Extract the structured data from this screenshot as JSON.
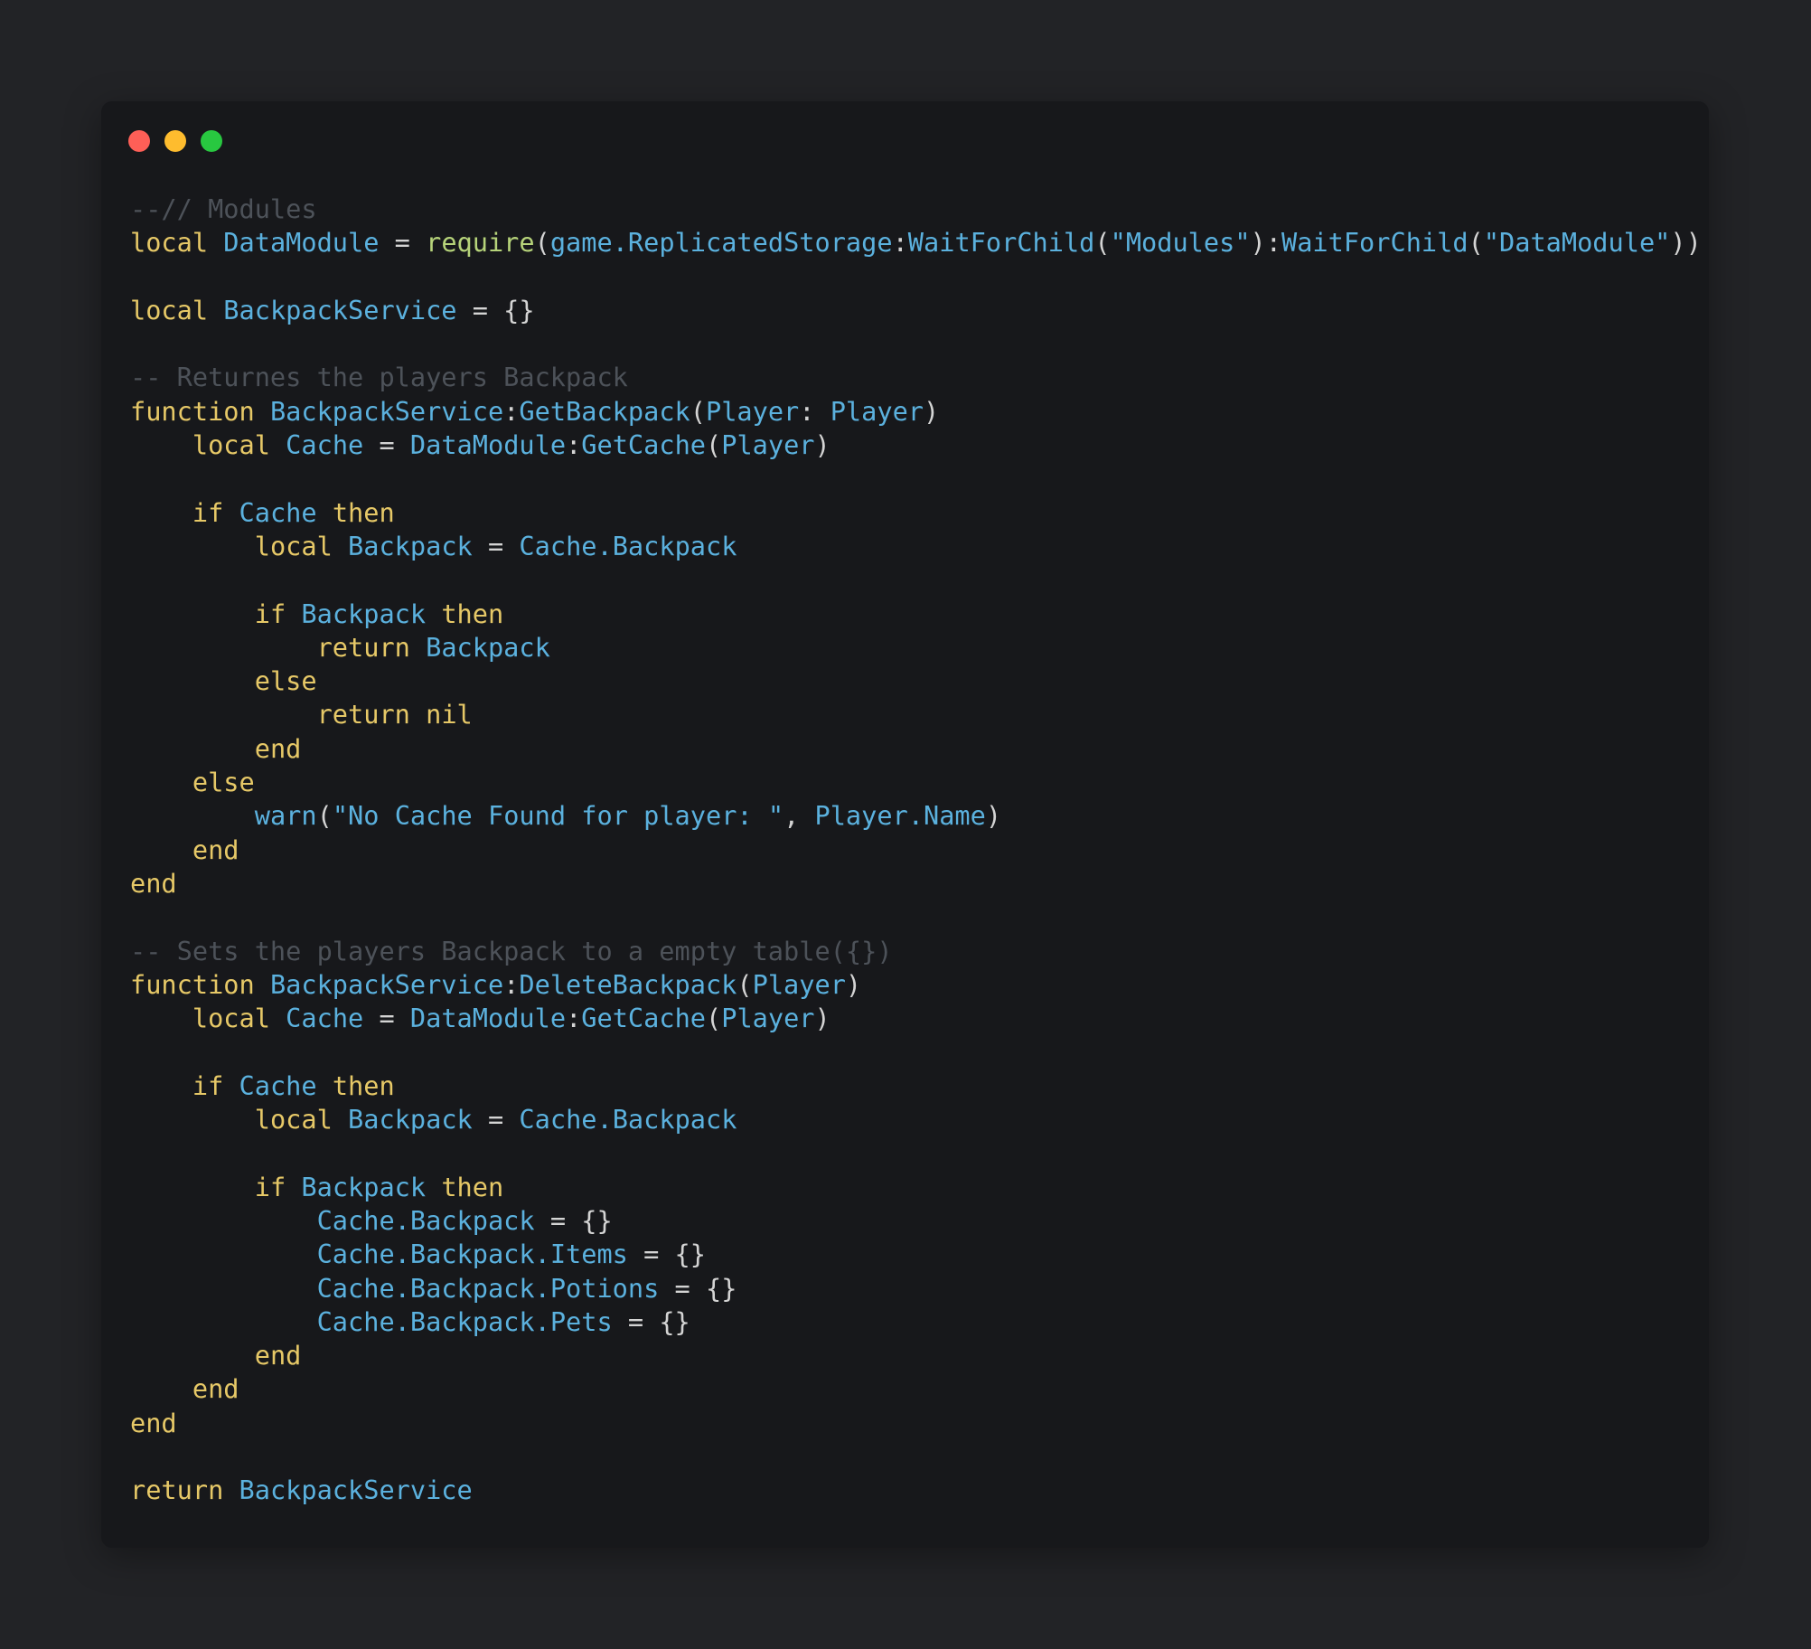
{
  "colors": {
    "background": "#222326",
    "window": "#17181b",
    "close_dot": "#fe5f57",
    "minimize_dot": "#febc2e",
    "maximize_dot": "#28c840",
    "keyword": "#e6c867",
    "identifier": "#5bb1de",
    "builtin": "#b6d37a",
    "comment": "#4d5259",
    "operator": "#d4d4d4"
  },
  "window_controls": [
    "close-dot",
    "minimize-dot",
    "maximize-dot"
  ],
  "code_lines": [
    [
      [
        "comment",
        "--// Modules"
      ]
    ],
    [
      [
        "keyword",
        "local "
      ],
      [
        "ident",
        "DataModule"
      ],
      [
        "op",
        " = "
      ],
      [
        "builtin",
        "require"
      ],
      [
        "op",
        "("
      ],
      [
        "ident",
        "game.ReplicatedStorage"
      ],
      [
        "op",
        ":"
      ],
      [
        "ident",
        "WaitForChild"
      ],
      [
        "op",
        "("
      ],
      [
        "string",
        "\"Modules\""
      ],
      [
        "op",
        "):"
      ],
      [
        "ident",
        "WaitForChild"
      ],
      [
        "op",
        "("
      ],
      [
        "string",
        "\"DataModule\""
      ],
      [
        "op",
        "))"
      ]
    ],
    [],
    [
      [
        "keyword",
        "local "
      ],
      [
        "ident",
        "BackpackService"
      ],
      [
        "op",
        " = {}"
      ]
    ],
    [],
    [
      [
        "comment",
        "-- Returnes the players Backpack"
      ]
    ],
    [
      [
        "keyword",
        "function "
      ],
      [
        "ident",
        "BackpackService"
      ],
      [
        "op",
        ":"
      ],
      [
        "ident",
        "GetBackpack"
      ],
      [
        "op",
        "("
      ],
      [
        "ident",
        "Player"
      ],
      [
        "op",
        ": "
      ],
      [
        "ident",
        "Player"
      ],
      [
        "op",
        ")"
      ]
    ],
    [
      [
        "plain",
        "    "
      ],
      [
        "keyword",
        "local "
      ],
      [
        "ident",
        "Cache"
      ],
      [
        "op",
        " = "
      ],
      [
        "ident",
        "DataModule"
      ],
      [
        "op",
        ":"
      ],
      [
        "ident",
        "GetCache"
      ],
      [
        "op",
        "("
      ],
      [
        "ident",
        "Player"
      ],
      [
        "op",
        ")"
      ]
    ],
    [],
    [
      [
        "plain",
        "    "
      ],
      [
        "keyword",
        "if "
      ],
      [
        "ident",
        "Cache"
      ],
      [
        "keyword",
        " then"
      ]
    ],
    [
      [
        "plain",
        "        "
      ],
      [
        "keyword",
        "local "
      ],
      [
        "ident",
        "Backpack"
      ],
      [
        "op",
        " = "
      ],
      [
        "ident",
        "Cache.Backpack"
      ]
    ],
    [],
    [
      [
        "plain",
        "        "
      ],
      [
        "keyword",
        "if "
      ],
      [
        "ident",
        "Backpack"
      ],
      [
        "keyword",
        " then"
      ]
    ],
    [
      [
        "plain",
        "            "
      ],
      [
        "keyword",
        "return "
      ],
      [
        "ident",
        "Backpack"
      ]
    ],
    [
      [
        "plain",
        "        "
      ],
      [
        "keyword",
        "else"
      ]
    ],
    [
      [
        "plain",
        "            "
      ],
      [
        "keyword",
        "return nil"
      ]
    ],
    [
      [
        "plain",
        "        "
      ],
      [
        "keyword",
        "end"
      ]
    ],
    [
      [
        "plain",
        "    "
      ],
      [
        "keyword",
        "else"
      ]
    ],
    [
      [
        "plain",
        "        "
      ],
      [
        "ident",
        "warn"
      ],
      [
        "op",
        "("
      ],
      [
        "string",
        "\"No Cache Found for player: \""
      ],
      [
        "op",
        ", "
      ],
      [
        "ident",
        "Player.Name"
      ],
      [
        "op",
        ")"
      ]
    ],
    [
      [
        "plain",
        "    "
      ],
      [
        "keyword",
        "end"
      ]
    ],
    [
      [
        "keyword",
        "end"
      ]
    ],
    [],
    [
      [
        "comment",
        "-- Sets the players Backpack to a empty table({})"
      ]
    ],
    [
      [
        "keyword",
        "function "
      ],
      [
        "ident",
        "BackpackService"
      ],
      [
        "op",
        ":"
      ],
      [
        "ident",
        "DeleteBackpack"
      ],
      [
        "op",
        "("
      ],
      [
        "ident",
        "Player"
      ],
      [
        "op",
        ")"
      ]
    ],
    [
      [
        "plain",
        "    "
      ],
      [
        "keyword",
        "local "
      ],
      [
        "ident",
        "Cache"
      ],
      [
        "op",
        " = "
      ],
      [
        "ident",
        "DataModule"
      ],
      [
        "op",
        ":"
      ],
      [
        "ident",
        "GetCache"
      ],
      [
        "op",
        "("
      ],
      [
        "ident",
        "Player"
      ],
      [
        "op",
        ")"
      ]
    ],
    [],
    [
      [
        "plain",
        "    "
      ],
      [
        "keyword",
        "if "
      ],
      [
        "ident",
        "Cache"
      ],
      [
        "keyword",
        " then"
      ]
    ],
    [
      [
        "plain",
        "        "
      ],
      [
        "keyword",
        "local "
      ],
      [
        "ident",
        "Backpack"
      ],
      [
        "op",
        " = "
      ],
      [
        "ident",
        "Cache.Backpack"
      ]
    ],
    [],
    [
      [
        "plain",
        "        "
      ],
      [
        "keyword",
        "if "
      ],
      [
        "ident",
        "Backpack"
      ],
      [
        "keyword",
        " then"
      ]
    ],
    [
      [
        "plain",
        "            "
      ],
      [
        "ident",
        "Cache.Backpack"
      ],
      [
        "op",
        " = {}"
      ]
    ],
    [
      [
        "plain",
        "            "
      ],
      [
        "ident",
        "Cache.Backpack.Items"
      ],
      [
        "op",
        " = {}"
      ]
    ],
    [
      [
        "plain",
        "            "
      ],
      [
        "ident",
        "Cache.Backpack.Potions"
      ],
      [
        "op",
        " = {}"
      ]
    ],
    [
      [
        "plain",
        "            "
      ],
      [
        "ident",
        "Cache.Backpack.Pets"
      ],
      [
        "op",
        " = {}"
      ]
    ],
    [
      [
        "plain",
        "        "
      ],
      [
        "keyword",
        "end"
      ]
    ],
    [
      [
        "plain",
        "    "
      ],
      [
        "keyword",
        "end"
      ]
    ],
    [
      [
        "keyword",
        "end"
      ]
    ],
    [],
    [
      [
        "keyword",
        "return "
      ],
      [
        "ident",
        "BackpackService"
      ]
    ]
  ]
}
